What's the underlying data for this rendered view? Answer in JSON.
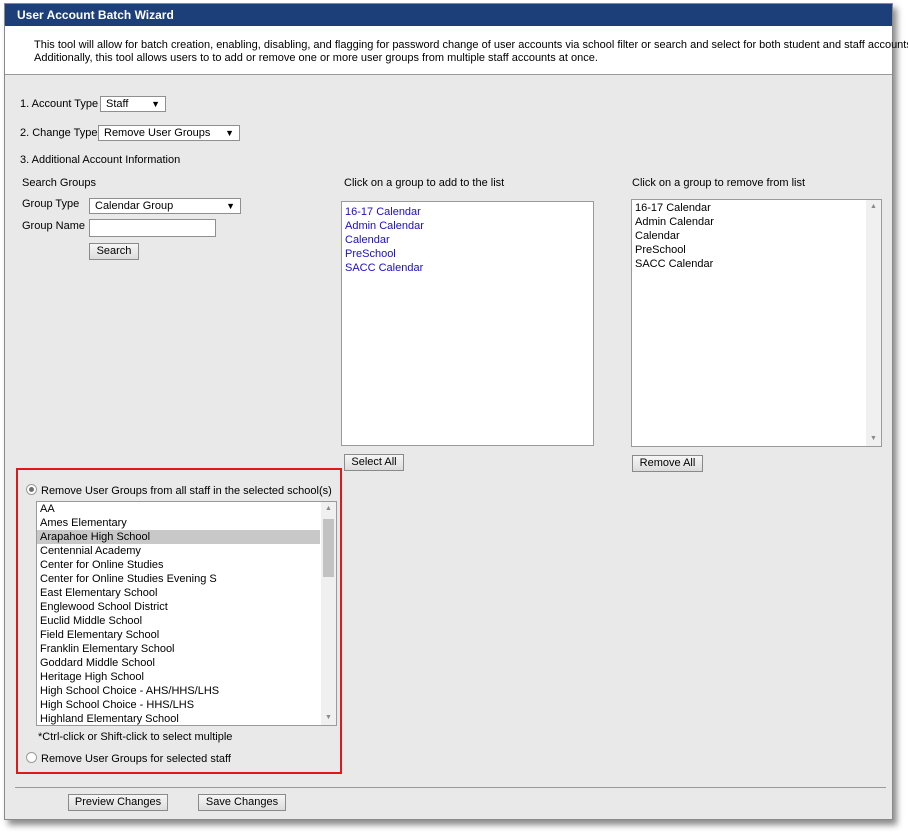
{
  "window": {
    "title": "User Account Batch Wizard"
  },
  "description": {
    "line1": "This tool will allow for batch creation, enabling, disabling, and flagging for password change of user accounts via school filter or search and select for both student and staff accounts.",
    "line2": "Additionally, this tool allows users to to add or remove one or more user groups from multiple staff accounts at once."
  },
  "form": {
    "account_type_label": "1. Account Type",
    "account_type_value": "Staff",
    "change_type_label": "2. Change Type",
    "change_type_value": "Remove User Groups",
    "additional_info_label": "3. Additional Account Information"
  },
  "search": {
    "heading": "Search Groups",
    "group_type_label": "Group Type",
    "group_type_value": "Calendar Group",
    "group_name_label": "Group Name",
    "group_name_value": "",
    "search_button": "Search"
  },
  "add_list": {
    "heading": "Click on a group to add to the list",
    "items": [
      "16-17 Calendar",
      "Admin Calendar",
      "Calendar",
      "PreSchool",
      "SACC Calendar"
    ],
    "select_all_button": "Select All"
  },
  "remove_list": {
    "heading": "Click on a group to remove from list",
    "items": [
      "16-17 Calendar",
      "Admin Calendar",
      "Calendar",
      "PreSchool",
      "SACC Calendar"
    ],
    "remove_all_button": "Remove All"
  },
  "schools": {
    "radio_all_label": "Remove User Groups from all staff in the selected school(s)",
    "radio_all_selected": true,
    "items": [
      "AA",
      "Ames Elementary",
      "Arapahoe High School",
      "Centennial Academy",
      "Center for Online Studies",
      "Center for Online Studies Evening S",
      "East Elementary School",
      "Englewood School District",
      "Euclid Middle School",
      "Field Elementary School",
      "Franklin Elementary School",
      "Goddard Middle School",
      "Heritage High School",
      "High School Choice - AHS/HHS/LHS",
      "High School Choice - HHS/LHS",
      "Highland Elementary School"
    ],
    "selected_item": "Arapahoe High School",
    "hint": "*Ctrl-click or Shift-click to select multiple",
    "radio_selected_staff_label": "Remove User Groups for selected staff",
    "radio_selected_staff_selected": false
  },
  "footer": {
    "preview_button": "Preview Changes",
    "save_button": "Save Changes"
  },
  "colors": {
    "title_bar": "#1c3f7a",
    "link_blue": "#1a0dcc",
    "highlight_box": "#e01818",
    "panel_bg": "#e9e9e9"
  }
}
